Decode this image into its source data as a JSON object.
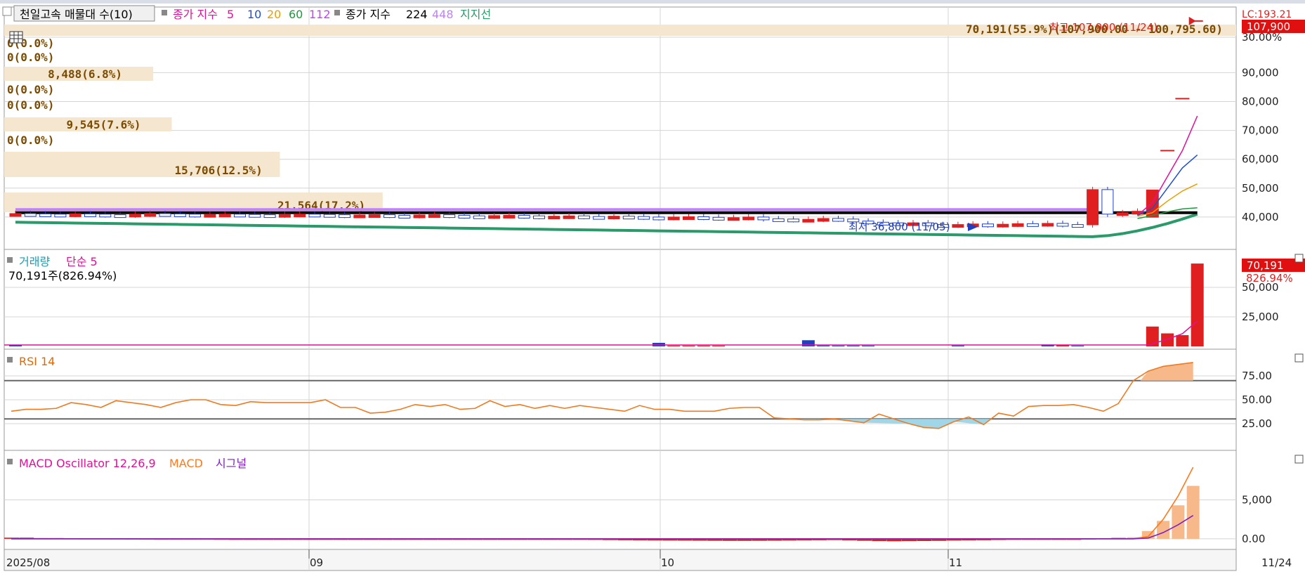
{
  "price_panel": {
    "legend": {
      "title": "천일고속 매물대 수(10)",
      "ma_title": "종가 지수",
      "ma_periods": [
        "5",
        "10",
        "20",
        "60",
        "112"
      ],
      "ma_colors": [
        "#e0109a",
        "#1f4fd0",
        "#e8a000",
        "#1a9a3a",
        "#c040ff"
      ],
      "ma2_title": "종가 지수",
      "ma2_periods": [
        "224",
        "448"
      ],
      "ma2_colors": [
        "#000000",
        "#c080ff"
      ],
      "support": "지지선",
      "support_color": "#2a9a6a"
    },
    "high_label": "최고 107,900 (11/24)",
    "low_label": "최저 36,800 (11/05)",
    "current_price": "107,900",
    "current_top": "LC:193.21",
    "right_pct": "30.00%"
  },
  "volume_panel": {
    "legend_title": "거래량",
    "legend_ma": "단순 5",
    "readout": "70,191주(826.94%)",
    "badge_value": "70,191",
    "badge_pct": "826.94%"
  },
  "rsi_panel": {
    "legend": "RSI 14"
  },
  "macd_panel": {
    "legend_osc": "MACD Oscillator 12,26,9",
    "legend_macd": "MACD",
    "legend_signal": "시그널"
  },
  "x_axis": {
    "labels": [
      "2025/08",
      "09",
      "10",
      "11"
    ],
    "last_label": "11/24"
  },
  "chart_data": [
    {
      "type": "bar",
      "name": "volume profile",
      "labels": [
        "70,191(55.9%)(107,900.00 - 100,795.60)",
        "0(0.0%)",
        "0(0.0%)",
        "8,488(6.8%)",
        "0(0.0%)",
        "0(0.0%)",
        "9,545(7.6%)",
        "0(0.0%)",
        "15,706(12.5%)",
        "21,564(17.2%)"
      ],
      "values": [
        70191,
        0,
        0,
        8488,
        0,
        0,
        9545,
        0,
        15706,
        21564
      ]
    },
    {
      "type": "line",
      "name": "price",
      "yticks": [
        "30.00%",
        "90,000",
        "80,000",
        "70,000",
        "60,000",
        "50,000",
        "40,000"
      ],
      "ylim": [
        30000,
        112000
      ],
      "close": [
        41200,
        41100,
        41000,
        40900,
        41100,
        41000,
        40800,
        40700,
        41000,
        41200,
        41100,
        41000,
        40800,
        40900,
        41000,
        40900,
        40800,
        40700,
        40900,
        41000,
        40900,
        40800,
        40600,
        40700,
        40800,
        40600,
        40500,
        40700,
        40800,
        40600,
        40400,
        40300,
        40500,
        40600,
        40400,
        40200,
        40300,
        40400,
        40200,
        40100,
        40300,
        40200,
        40000,
        39800,
        40000,
        40100,
        39900,
        39700,
        39800,
        40000,
        39400,
        39300,
        39100,
        39200,
        39500,
        39300,
        38600,
        38200,
        38000,
        37800,
        38000,
        37400,
        37200,
        37400,
        37600,
        37300,
        37500,
        37700,
        37600,
        37800,
        37400,
        37300,
        49500,
        41000,
        41500,
        42000
      ],
      "low_value": 36800,
      "high_value": 107900,
      "ma5_end": [
        40600,
        45000,
        54000,
        63000,
        75000
      ],
      "ma10_end": [
        40500,
        43000,
        50000,
        57000,
        61500
      ],
      "ma20_end": [
        40300,
        41500,
        45500,
        49000,
        51500
      ],
      "ma60_end": [
        39500,
        40500,
        41800,
        42800,
        43200
      ],
      "long_ma": 41500,
      "ma112": 42600,
      "support_start": 38200,
      "support_low": 33200,
      "support_end": 41000
    },
    {
      "type": "bar",
      "name": "volume",
      "yticks": [
        "50,000",
        "25,000"
      ],
      "ylim": [
        0,
        75000
      ],
      "bars": [
        {
          "i": 0,
          "v": 1200,
          "c": "blue"
        },
        {
          "i": 43,
          "v": 3000,
          "c": "blue"
        },
        {
          "i": 44,
          "v": 600,
          "c": "red"
        },
        {
          "i": 45,
          "v": 600,
          "c": "red"
        },
        {
          "i": 46,
          "v": 600,
          "c": "red"
        },
        {
          "i": 47,
          "v": 600,
          "c": "red"
        },
        {
          "i": 53,
          "v": 5200,
          "c": "blue"
        },
        {
          "i": 54,
          "v": 700,
          "c": "blue"
        },
        {
          "i": 55,
          "v": 600,
          "c": "blue"
        },
        {
          "i": 56,
          "v": 600,
          "c": "blue"
        },
        {
          "i": 57,
          "v": 600,
          "c": "blue"
        },
        {
          "i": 63,
          "v": 700,
          "c": "blue"
        },
        {
          "i": 69,
          "v": 1600,
          "c": "blue"
        },
        {
          "i": 70,
          "v": 1000,
          "c": "red"
        },
        {
          "i": 71,
          "v": 600,
          "c": "blue"
        },
        {
          "i": 76,
          "v": 16800,
          "c": "red"
        },
        {
          "i": 77,
          "v": 11000,
          "c": "red"
        },
        {
          "i": 78,
          "v": 9500,
          "c": "red"
        },
        {
          "i": 79,
          "v": 70191,
          "c": "red"
        }
      ]
    },
    {
      "type": "line",
      "name": "RSI 14",
      "yticks": [
        "75.00",
        "50.00",
        "25.00"
      ],
      "ylim": [
        0,
        100
      ],
      "upper": 70,
      "lower": 30,
      "values": [
        38,
        40,
        40,
        41,
        47,
        45,
        42,
        49,
        47,
        45,
        42,
        47,
        50,
        50,
        45,
        44,
        48,
        47,
        47,
        47,
        47,
        50,
        42,
        42,
        36,
        37,
        40,
        45,
        43,
        45,
        40,
        41,
        49,
        43,
        45,
        41,
        44,
        41,
        44,
        42,
        40,
        38,
        44,
        40,
        40,
        38,
        38,
        38,
        41,
        42,
        42,
        31,
        30,
        29,
        29,
        30,
        28,
        26,
        35,
        30,
        25,
        21,
        20,
        27,
        32,
        24,
        36,
        33,
        43,
        44,
        44,
        45,
        42,
        38,
        46,
        70,
        80,
        85,
        87,
        89
      ]
    },
    {
      "type": "bar",
      "name": "MACD Oscillator 12,26,9",
      "yticks": [
        "5,000",
        "0.00"
      ],
      "ylim": [
        -1000,
        11000
      ],
      "osc": [
        150,
        150,
        100,
        100,
        80,
        60,
        60,
        50,
        40,
        30,
        20,
        20,
        20,
        20,
        10,
        0,
        -30,
        -50,
        -60,
        -80,
        -60,
        -80,
        -100,
        -120,
        -120,
        -110,
        -100,
        -80,
        -60,
        -40,
        -20,
        -10,
        0,
        -20,
        -40,
        -60,
        -80,
        -100,
        -120,
        -140,
        -160,
        -180,
        -200,
        -210,
        -220,
        -230,
        -240,
        -250,
        -260,
        -260,
        -250,
        -240,
        -220,
        -200,
        -180,
        -160,
        -200,
        -250,
        -300,
        -320,
        -300,
        -280,
        -260,
        -220,
        -200,
        -180,
        -150,
        -120,
        -80,
        -40,
        -20,
        0,
        40,
        80,
        120,
        200,
        1000,
        2300,
        4300,
        6800
      ],
      "macd_end": [
        0,
        300,
        2500,
        5500,
        9200
      ],
      "signal_end": [
        0,
        100,
        800,
        1800,
        3000
      ]
    }
  ],
  "colors": {
    "up": "#e02020",
    "down": "#2040c0",
    "grid": "#d4d4d4",
    "band": "#f5e6d0",
    "rsi_fill": "#f7b88a",
    "rsi_low_fill": "#9fd6e8",
    "macd": "#ff7a1a",
    "signal": "#8020c0",
    "badge": "#e01010"
  }
}
